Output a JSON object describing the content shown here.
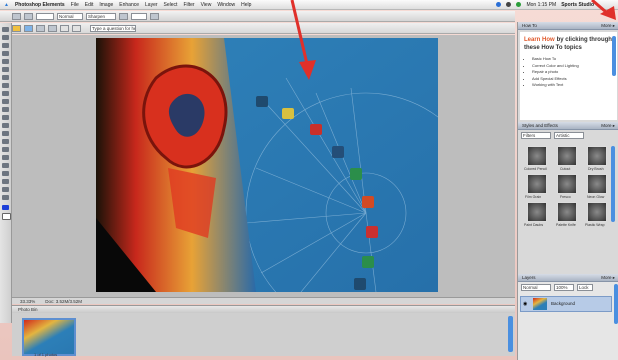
{
  "menubar": {
    "app_name": "Photoshop Elements",
    "menus": [
      "File",
      "Edit",
      "Image",
      "Enhance",
      "Layer",
      "Select",
      "Filter",
      "View",
      "Window",
      "Help"
    ],
    "clock": "Mon 1:15 PM",
    "user": "Sports Studio"
  },
  "options_bar": {
    "mode_value": "Normal",
    "size_value": "Sharpen"
  },
  "toolbar2": {
    "search_value": "Type a question for help"
  },
  "how_to": {
    "header": "How To",
    "title": "Learn How",
    "body": "by clicking through these How To topics",
    "topics": [
      "Basic How To",
      "Correct Color and Lighting",
      "Repair a photo",
      "Add Special Effects",
      "Working with Text"
    ]
  },
  "styles_effects": {
    "header": "Styles and Effects",
    "filter_value": "Filters",
    "category_value": "Artistic",
    "items": [
      "Colored Pencil",
      "Cutout",
      "Dry Brush",
      "Film Grain",
      "Fresco",
      "Neon Glow",
      "Paint Daubs",
      "Palette Knife",
      "Plastic Wrap"
    ]
  },
  "layers": {
    "header": "Layers",
    "blend_mode": "Normal",
    "opacity": "100%",
    "layer_name": "Background",
    "lock_label": "Lock"
  },
  "status": {
    "zoom": "33.33%",
    "doc_size": "Doc: 3.52M/3.52M"
  },
  "photo_bin": {
    "header": "Photo Bin",
    "label": "1 of 1 photos"
  },
  "annotation": {
    "arrow_color": "#e0302a"
  }
}
